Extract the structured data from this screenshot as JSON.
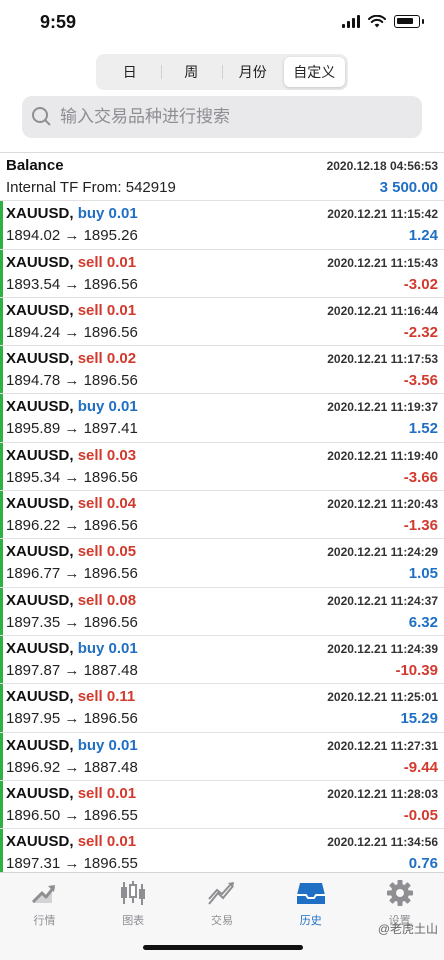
{
  "status_bar": {
    "time": "9:59"
  },
  "segmented": {
    "tabs": [
      "日",
      "周",
      "月份",
      "自定义"
    ],
    "active_index": 3
  },
  "search": {
    "placeholder": "输入交易品种进行搜索"
  },
  "balance": {
    "title": "Balance",
    "description": "Internal TF From: 542919",
    "time": "2020.12.18 04:56:53",
    "amount": "3 500.00"
  },
  "trades": [
    {
      "symbol": "XAUUSD,",
      "side": "buy",
      "volume": "0.01",
      "open": "1894.02",
      "close": "1895.26",
      "time": "2020.12.21 11:15:42",
      "profit": "1.24"
    },
    {
      "symbol": "XAUUSD,",
      "side": "sell",
      "volume": "0.01",
      "open": "1893.54",
      "close": "1896.56",
      "time": "2020.12.21 11:15:43",
      "profit": "-3.02"
    },
    {
      "symbol": "XAUUSD,",
      "side": "sell",
      "volume": "0.01",
      "open": "1894.24",
      "close": "1896.56",
      "time": "2020.12.21 11:16:44",
      "profit": "-2.32"
    },
    {
      "symbol": "XAUUSD,",
      "side": "sell",
      "volume": "0.02",
      "open": "1894.78",
      "close": "1896.56",
      "time": "2020.12.21 11:17:53",
      "profit": "-3.56"
    },
    {
      "symbol": "XAUUSD,",
      "side": "buy",
      "volume": "0.01",
      "open": "1895.89",
      "close": "1897.41",
      "time": "2020.12.21 11:19:37",
      "profit": "1.52"
    },
    {
      "symbol": "XAUUSD,",
      "side": "sell",
      "volume": "0.03",
      "open": "1895.34",
      "close": "1896.56",
      "time": "2020.12.21 11:19:40",
      "profit": "-3.66"
    },
    {
      "symbol": "XAUUSD,",
      "side": "sell",
      "volume": "0.04",
      "open": "1896.22",
      "close": "1896.56",
      "time": "2020.12.21 11:20:43",
      "profit": "-1.36"
    },
    {
      "symbol": "XAUUSD,",
      "side": "sell",
      "volume": "0.05",
      "open": "1896.77",
      "close": "1896.56",
      "time": "2020.12.21 11:24:29",
      "profit": "1.05"
    },
    {
      "symbol": "XAUUSD,",
      "side": "sell",
      "volume": "0.08",
      "open": "1897.35",
      "close": "1896.56",
      "time": "2020.12.21 11:24:37",
      "profit": "6.32"
    },
    {
      "symbol": "XAUUSD,",
      "side": "buy",
      "volume": "0.01",
      "open": "1897.87",
      "close": "1887.48",
      "time": "2020.12.21 11:24:39",
      "profit": "-10.39"
    },
    {
      "symbol": "XAUUSD,",
      "side": "sell",
      "volume": "0.11",
      "open": "1897.95",
      "close": "1896.56",
      "time": "2020.12.21 11:25:01",
      "profit": "15.29"
    },
    {
      "symbol": "XAUUSD,",
      "side": "buy",
      "volume": "0.01",
      "open": "1896.92",
      "close": "1887.48",
      "time": "2020.12.21 11:27:31",
      "profit": "-9.44"
    },
    {
      "symbol": "XAUUSD,",
      "side": "sell",
      "volume": "0.01",
      "open": "1896.50",
      "close": "1896.55",
      "time": "2020.12.21 11:28:03",
      "profit": "-0.05"
    },
    {
      "symbol": "XAUUSD,",
      "side": "sell",
      "volume": "0.01",
      "open": "1897.31",
      "close": "1896.55",
      "time": "2020.12.21 11:34:56",
      "profit": "0.76"
    }
  ],
  "tabbar": {
    "items": [
      {
        "label": "行情",
        "icon": "quotes-icon"
      },
      {
        "label": "图表",
        "icon": "chart-icon"
      },
      {
        "label": "交易",
        "icon": "trade-icon"
      },
      {
        "label": "历史",
        "icon": "history-icon"
      },
      {
        "label": "设置",
        "icon": "settings-icon"
      }
    ],
    "active_index": 3
  },
  "watermark": "@老虎土山",
  "colors": {
    "buy": "#1f6fc4",
    "sell": "#d23a2e",
    "accent": "#1f6fc4",
    "trade_marker": "#2fb042"
  }
}
